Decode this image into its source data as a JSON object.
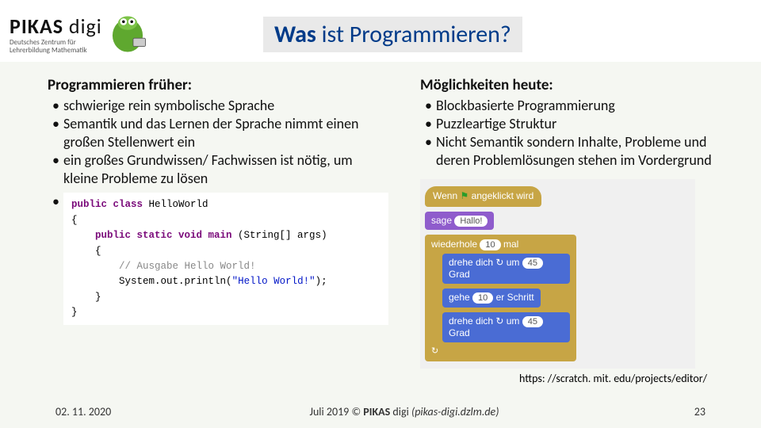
{
  "header": {
    "logo_main": "PIKAS",
    "logo_digi": " digi",
    "logo_sub1": "Deutsches Zentrum für",
    "logo_sub2": "Lehrerbildung Mathematik",
    "title_bold": "Was",
    "title_rest": " ist Programmieren?"
  },
  "left": {
    "heading": "Programmieren früher:",
    "items": [
      "schwierige rein symbolische Sprache",
      "Semantik und das Lernen der Sprache nimmt einen großen Stellenwert ein",
      "ein großes  Grundwissen/ Fachwissen ist nötig, um kleine Probleme zu lösen"
    ],
    "code": {
      "l1a": "public class ",
      "l1b": "HelloWorld",
      "l2": "{",
      "l3a": "    public static void main ",
      "l3b": "(String[] args)",
      "l4": "    {",
      "l5": "        // Ausgabe Hello World!",
      "l6a": "        System.",
      "l6b": "out",
      "l6c": ".println(",
      "l6d": "\"Hello World!\"",
      "l6e": ");",
      "l7": "    }",
      "l8": "}"
    }
  },
  "right": {
    "heading": "Möglichkeiten heute:",
    "items": [
      "Blockbasierte Programmierung",
      "Puzzleartige Struktur",
      "Nicht Semantik sondern Inhalte, Probleme und deren Problemlösungen stehen im Vordergrund"
    ],
    "scratch": {
      "when": "Wenn ",
      "clicked": " angeklickt wird",
      "say": "sage ",
      "hallo": "Hallo!",
      "repeat": "wiederhole ",
      "ten": "10",
      "times": " mal",
      "turn1": "drehe dich ↻ um ",
      "deg": "45",
      "grad": " Grad",
      "go": "gehe ",
      "steps": " er Schritt",
      "turn2": "drehe dich ↻ um "
    },
    "source": "https: //scratch. mit. edu/projects/editor/"
  },
  "footer": {
    "date": "02. 11. 2020",
    "center_pre": "Juli 2019 © ",
    "center_b": "PIKAS",
    "center_mid": " digi ",
    "center_i": "(pikas-digi.dzlm.de)",
    "page": "23"
  }
}
